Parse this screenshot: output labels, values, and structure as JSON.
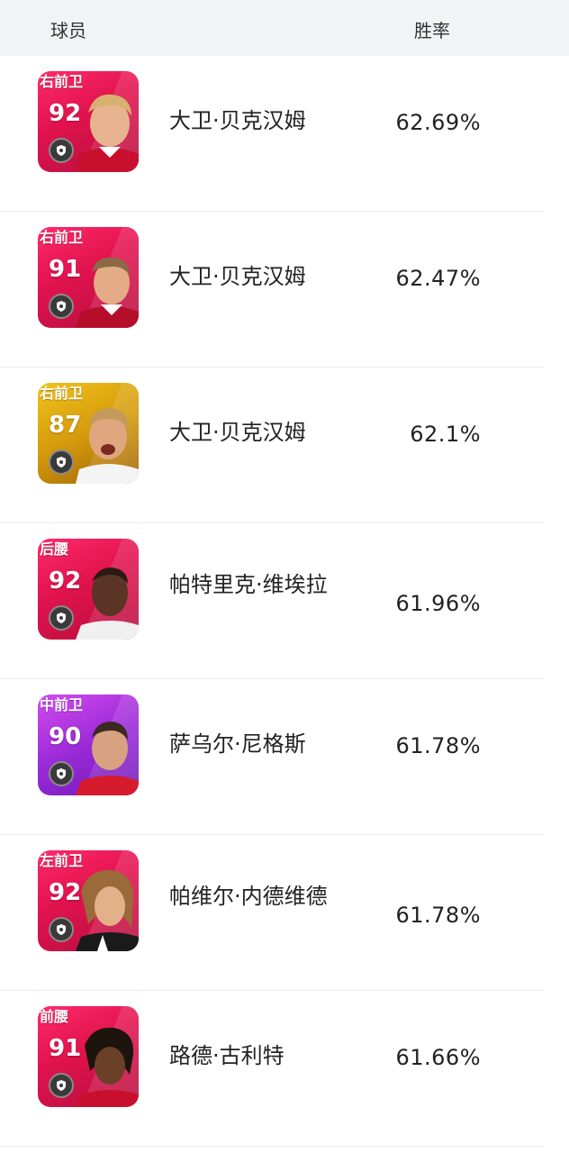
{
  "header": {
    "player_label": "球员",
    "rate_label": "胜率"
  },
  "colors": {
    "card_red": "#e0124d",
    "card_gold": "#d59a0c",
    "card_purple": "#9b2ad8",
    "header_bg": "#f2f3f5"
  },
  "players": [
    {
      "position": "右前卫",
      "rating": "92",
      "name": "大卫·贝克汉姆",
      "win_rate": "62.69%",
      "card_color": "red"
    },
    {
      "position": "右前卫",
      "rating": "91",
      "name": "大卫·贝克汉姆",
      "win_rate": "62.47%",
      "card_color": "red"
    },
    {
      "position": "右前卫",
      "rating": "87",
      "name": "大卫·贝克汉姆",
      "win_rate": "62.1%",
      "card_color": "gold"
    },
    {
      "position": "后腰",
      "rating": "92",
      "name": "帕特里克·维埃拉",
      "win_rate": "61.96%",
      "card_color": "red"
    },
    {
      "position": "中前卫",
      "rating": "90",
      "name": "萨乌尔·尼格斯",
      "win_rate": "61.78%",
      "card_color": "purple"
    },
    {
      "position": "左前卫",
      "rating": "92",
      "name": "帕维尔·内德维德",
      "win_rate": "61.78%",
      "card_color": "red"
    },
    {
      "position": "前腰",
      "rating": "91",
      "name": "路德·古利特",
      "win_rate": "61.66%",
      "card_color": "red"
    }
  ]
}
